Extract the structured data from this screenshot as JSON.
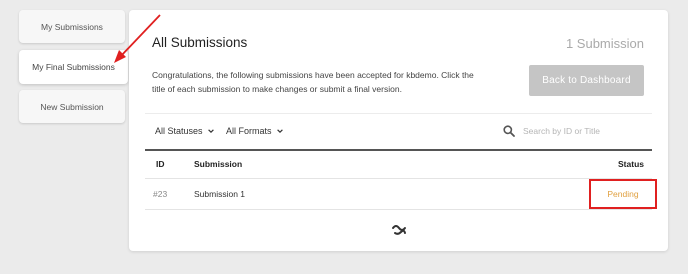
{
  "sidebar": {
    "items": [
      {
        "label": "My Submissions"
      },
      {
        "label": "My Final Submissions"
      },
      {
        "label": "New Submission"
      }
    ]
  },
  "panel": {
    "title": "All Submissions",
    "count": "1 Submission",
    "description": "Congratulations, the following submissions have been accepted for kbdemo. Click the title of each submission to make changes or submit a final version.",
    "back_button": "Back to Dashboard"
  },
  "filters": {
    "statuses": "All Statuses",
    "formats": "All Formats",
    "search_placeholder": "Search by ID or Title"
  },
  "table": {
    "headers": {
      "id": "ID",
      "submission": "Submission",
      "status": "Status"
    },
    "rows": [
      {
        "id": "#23",
        "submission": "Submission 1",
        "status": "Pending"
      }
    ]
  },
  "colors": {
    "annotation": "#e02020",
    "status_pending": "#e0a040",
    "button_disabled": "#c5c5c5"
  },
  "icons": {
    "search": "search-icon",
    "chevron": "chevron-down-icon",
    "loader": "loading-icon",
    "annotation": "annotation-arrow"
  }
}
